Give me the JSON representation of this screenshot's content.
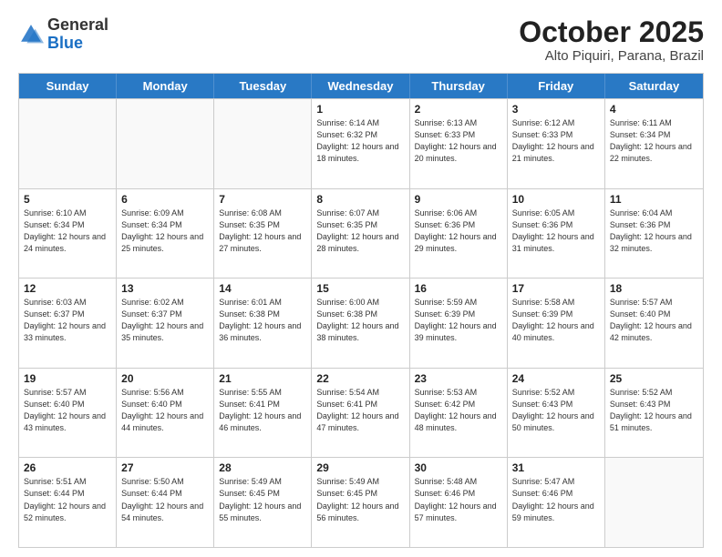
{
  "header": {
    "logo_general": "General",
    "logo_blue": "Blue",
    "month": "October 2025",
    "location": "Alto Piquiri, Parana, Brazil"
  },
  "weekdays": [
    "Sunday",
    "Monday",
    "Tuesday",
    "Wednesday",
    "Thursday",
    "Friday",
    "Saturday"
  ],
  "rows": [
    [
      {
        "day": "",
        "info": ""
      },
      {
        "day": "",
        "info": ""
      },
      {
        "day": "",
        "info": ""
      },
      {
        "day": "1",
        "info": "Sunrise: 6:14 AM\nSunset: 6:32 PM\nDaylight: 12 hours\nand 18 minutes."
      },
      {
        "day": "2",
        "info": "Sunrise: 6:13 AM\nSunset: 6:33 PM\nDaylight: 12 hours\nand 20 minutes."
      },
      {
        "day": "3",
        "info": "Sunrise: 6:12 AM\nSunset: 6:33 PM\nDaylight: 12 hours\nand 21 minutes."
      },
      {
        "day": "4",
        "info": "Sunrise: 6:11 AM\nSunset: 6:34 PM\nDaylight: 12 hours\nand 22 minutes."
      }
    ],
    [
      {
        "day": "5",
        "info": "Sunrise: 6:10 AM\nSunset: 6:34 PM\nDaylight: 12 hours\nand 24 minutes."
      },
      {
        "day": "6",
        "info": "Sunrise: 6:09 AM\nSunset: 6:34 PM\nDaylight: 12 hours\nand 25 minutes."
      },
      {
        "day": "7",
        "info": "Sunrise: 6:08 AM\nSunset: 6:35 PM\nDaylight: 12 hours\nand 27 minutes."
      },
      {
        "day": "8",
        "info": "Sunrise: 6:07 AM\nSunset: 6:35 PM\nDaylight: 12 hours\nand 28 minutes."
      },
      {
        "day": "9",
        "info": "Sunrise: 6:06 AM\nSunset: 6:36 PM\nDaylight: 12 hours\nand 29 minutes."
      },
      {
        "day": "10",
        "info": "Sunrise: 6:05 AM\nSunset: 6:36 PM\nDaylight: 12 hours\nand 31 minutes."
      },
      {
        "day": "11",
        "info": "Sunrise: 6:04 AM\nSunset: 6:36 PM\nDaylight: 12 hours\nand 32 minutes."
      }
    ],
    [
      {
        "day": "12",
        "info": "Sunrise: 6:03 AM\nSunset: 6:37 PM\nDaylight: 12 hours\nand 33 minutes."
      },
      {
        "day": "13",
        "info": "Sunrise: 6:02 AM\nSunset: 6:37 PM\nDaylight: 12 hours\nand 35 minutes."
      },
      {
        "day": "14",
        "info": "Sunrise: 6:01 AM\nSunset: 6:38 PM\nDaylight: 12 hours\nand 36 minutes."
      },
      {
        "day": "15",
        "info": "Sunrise: 6:00 AM\nSunset: 6:38 PM\nDaylight: 12 hours\nand 38 minutes."
      },
      {
        "day": "16",
        "info": "Sunrise: 5:59 AM\nSunset: 6:39 PM\nDaylight: 12 hours\nand 39 minutes."
      },
      {
        "day": "17",
        "info": "Sunrise: 5:58 AM\nSunset: 6:39 PM\nDaylight: 12 hours\nand 40 minutes."
      },
      {
        "day": "18",
        "info": "Sunrise: 5:57 AM\nSunset: 6:40 PM\nDaylight: 12 hours\nand 42 minutes."
      }
    ],
    [
      {
        "day": "19",
        "info": "Sunrise: 5:57 AM\nSunset: 6:40 PM\nDaylight: 12 hours\nand 43 minutes."
      },
      {
        "day": "20",
        "info": "Sunrise: 5:56 AM\nSunset: 6:40 PM\nDaylight: 12 hours\nand 44 minutes."
      },
      {
        "day": "21",
        "info": "Sunrise: 5:55 AM\nSunset: 6:41 PM\nDaylight: 12 hours\nand 46 minutes."
      },
      {
        "day": "22",
        "info": "Sunrise: 5:54 AM\nSunset: 6:41 PM\nDaylight: 12 hours\nand 47 minutes."
      },
      {
        "day": "23",
        "info": "Sunrise: 5:53 AM\nSunset: 6:42 PM\nDaylight: 12 hours\nand 48 minutes."
      },
      {
        "day": "24",
        "info": "Sunrise: 5:52 AM\nSunset: 6:43 PM\nDaylight: 12 hours\nand 50 minutes."
      },
      {
        "day": "25",
        "info": "Sunrise: 5:52 AM\nSunset: 6:43 PM\nDaylight: 12 hours\nand 51 minutes."
      }
    ],
    [
      {
        "day": "26",
        "info": "Sunrise: 5:51 AM\nSunset: 6:44 PM\nDaylight: 12 hours\nand 52 minutes."
      },
      {
        "day": "27",
        "info": "Sunrise: 5:50 AM\nSunset: 6:44 PM\nDaylight: 12 hours\nand 54 minutes."
      },
      {
        "day": "28",
        "info": "Sunrise: 5:49 AM\nSunset: 6:45 PM\nDaylight: 12 hours\nand 55 minutes."
      },
      {
        "day": "29",
        "info": "Sunrise: 5:49 AM\nSunset: 6:45 PM\nDaylight: 12 hours\nand 56 minutes."
      },
      {
        "day": "30",
        "info": "Sunrise: 5:48 AM\nSunset: 6:46 PM\nDaylight: 12 hours\nand 57 minutes."
      },
      {
        "day": "31",
        "info": "Sunrise: 5:47 AM\nSunset: 6:46 PM\nDaylight: 12 hours\nand 59 minutes."
      },
      {
        "day": "",
        "info": ""
      }
    ]
  ]
}
